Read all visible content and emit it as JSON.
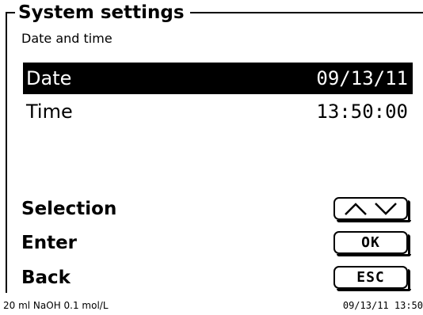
{
  "header": {
    "title": "System settings",
    "subtitle": "Date and time"
  },
  "settings": [
    {
      "label": "Date",
      "value": "09/13/11",
      "selected": true
    },
    {
      "label": "Time",
      "value": "13:50:00",
      "selected": false
    }
  ],
  "actions": {
    "selection_label": "Selection",
    "enter_label": "Enter",
    "back_label": "Back",
    "ok_key": "OK",
    "esc_key": "ESC",
    "arrow_icons": [
      "arrow-up-icon",
      "arrow-down-icon"
    ]
  },
  "status_bar": {
    "method": "20 ml NaOH 0.1 mol/L",
    "datetime": "09/13/11 13:50"
  }
}
